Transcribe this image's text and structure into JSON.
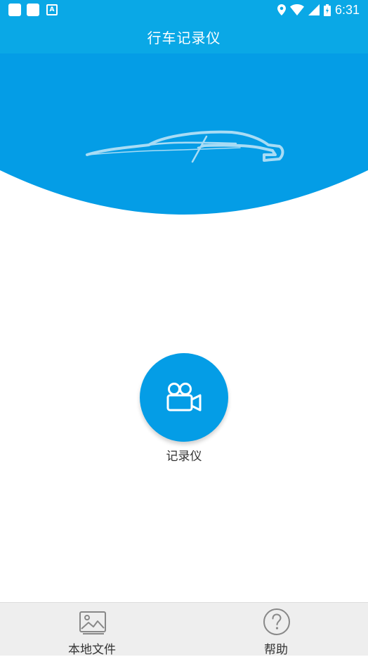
{
  "status_bar": {
    "time": "6:31",
    "left_icons": [
      "app-square-icon",
      "app-square-icon",
      "font-a-icon"
    ],
    "right_icons": [
      "location-icon",
      "wifi-icon",
      "signal-icon",
      "battery-icon"
    ]
  },
  "header": {
    "title": "行车记录仪",
    "background_color": "#0aa8e6"
  },
  "hero": {
    "background_color": "#049de6",
    "image": "car-silhouette"
  },
  "main": {
    "record_button": {
      "label": "记录仪",
      "icon": "video-camera-icon",
      "color": "#049de6"
    }
  },
  "bottom_nav": {
    "items": [
      {
        "label": "本地文件",
        "icon": "image-gallery-icon"
      },
      {
        "label": "帮助",
        "icon": "help-circle-icon"
      }
    ]
  }
}
